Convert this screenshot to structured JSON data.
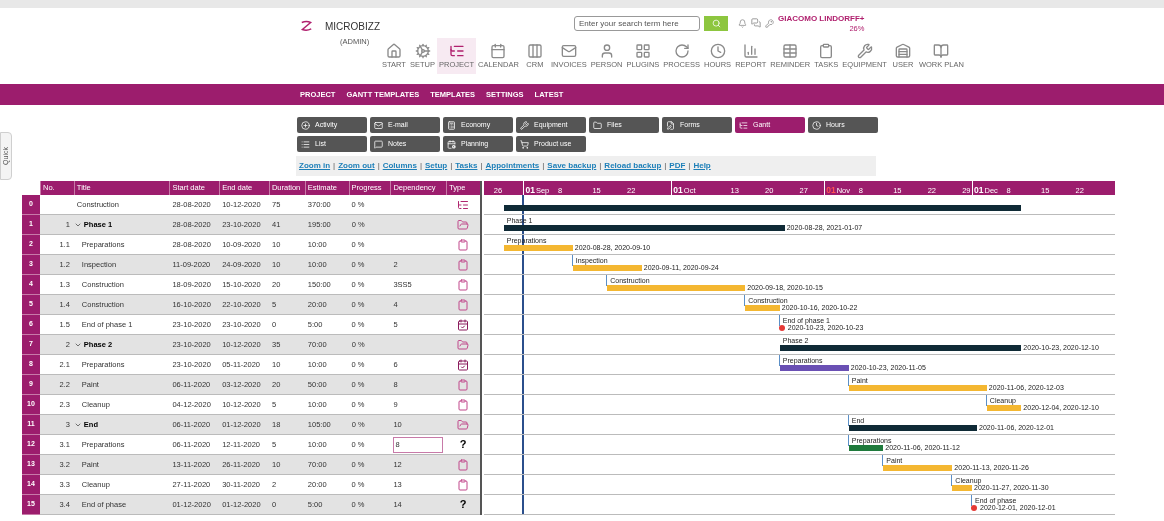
{
  "side_tab": {
    "label": "Quick"
  },
  "header": {
    "logo_text": "MICROBIZZ",
    "role": "(ADMIN)",
    "search": {
      "placeholder": "Enter your search term here"
    },
    "user": "GIACOMO LINDORFF+",
    "user_note": "26%"
  },
  "toolbar": [
    {
      "label": "START",
      "selected": false
    },
    {
      "label": "SETUP",
      "selected": false
    },
    {
      "label": "PROJECT",
      "selected": true
    },
    {
      "label": "CALENDAR",
      "selected": false
    },
    {
      "label": "CRM",
      "selected": false
    },
    {
      "label": "INVOICES",
      "selected": false
    },
    {
      "label": "PERSON",
      "selected": false
    },
    {
      "label": "PLUGINS",
      "selected": false
    },
    {
      "label": "PROCESS",
      "selected": false
    },
    {
      "label": "HOURS",
      "selected": false
    },
    {
      "label": "REPORT",
      "selected": false
    },
    {
      "label": "REMINDER",
      "selected": false
    },
    {
      "label": "TASKS",
      "selected": false
    },
    {
      "label": "EQUIPMENT",
      "selected": false
    },
    {
      "label": "USER",
      "selected": false
    },
    {
      "label": "WORK PLAN",
      "selected": false
    }
  ],
  "nav": [
    "PROJECT",
    "GANTT TEMPLATES",
    "TEMPLATES",
    "SETTINGS",
    "LATEST"
  ],
  "modules": [
    {
      "label": "Activity",
      "selected": false
    },
    {
      "label": "E-mail",
      "selected": false
    },
    {
      "label": "Economy",
      "selected": false
    },
    {
      "label": "Equipment",
      "selected": false
    },
    {
      "label": "Files",
      "selected": false
    },
    {
      "label": "Forms",
      "selected": false
    },
    {
      "label": "Gantt",
      "selected": true
    },
    {
      "label": "Hours",
      "selected": false
    },
    {
      "label": "List",
      "selected": false
    },
    {
      "label": "Notes",
      "selected": false
    },
    {
      "label": "Planning",
      "selected": false
    },
    {
      "label": "Product use",
      "selected": false
    }
  ],
  "links": {
    "separator": "|",
    "items": [
      "Zoom in",
      "Zoom out",
      "Columns",
      "Setup",
      "Tasks",
      "Appointments",
      "Save backup",
      "Reload backup",
      "PDF",
      "Help"
    ]
  },
  "table": {
    "columns": [
      "No.",
      "Title",
      "Start date",
      "End date",
      "Duration",
      "Estimate",
      "Progress",
      "Dependency",
      "Type"
    ],
    "rows": [
      {
        "row_number": "0",
        "no": "",
        "title": "Construction",
        "kind": "project",
        "start": "28-08-2020",
        "end": "10-12-2020",
        "duration": "75",
        "estimate": "370:00",
        "progress": "0 %",
        "dependency": "",
        "editing": false,
        "type": {
          "kind": "project"
        },
        "bar": {
          "kind": "summary",
          "color": "#0f2a36",
          "linked": false
        }
      },
      {
        "row_number": "1",
        "no": "1",
        "title": "Phase 1",
        "kind": "phase",
        "expanded": true,
        "start": "28-08-2020",
        "end": "23-10-2020",
        "duration": "41",
        "estimate": "195:00",
        "progress": "0 %",
        "dependency": "",
        "editing": false,
        "type": {
          "kind": "phase"
        },
        "bar": {
          "kind": "summary",
          "color": "#0f2a36",
          "linked": false,
          "label": "Phase 1",
          "dates": "2020-08-28, 2021-01-07"
        }
      },
      {
        "row_number": "2",
        "no": "1.1",
        "title": "Preparations",
        "kind": "task",
        "start": "28-08-2020",
        "end": "10-09-2020",
        "duration": "10",
        "estimate": "10:00",
        "progress": "0 %",
        "dependency": "",
        "editing": false,
        "type": {
          "kind": "task"
        },
        "bar": {
          "kind": "task",
          "color": "#f4b731",
          "linked": false,
          "label": "Preparations",
          "dates": "2020-08-28, 2020-09-10"
        }
      },
      {
        "row_number": "3",
        "no": "1.2",
        "title": "Inspection",
        "kind": "task",
        "start": "11-09-2020",
        "end": "24-09-2020",
        "duration": "10",
        "estimate": "10:00",
        "progress": "0 %",
        "dependency": "2",
        "editing": false,
        "type": {
          "kind": "task"
        },
        "bar": {
          "kind": "task",
          "color": "#f4b731",
          "linked": true,
          "label": "Inspection",
          "dates": "2020-09-11, 2020-09-24"
        }
      },
      {
        "row_number": "4",
        "no": "1.3",
        "title": "Construction",
        "kind": "task",
        "start": "18-09-2020",
        "end": "15-10-2020",
        "duration": "20",
        "estimate": "150:00",
        "progress": "0 %",
        "dependency": "3SS5",
        "editing": false,
        "type": {
          "kind": "task"
        },
        "bar": {
          "kind": "task",
          "color": "#f4b731",
          "linked": true,
          "label": "Construction",
          "dates": "2020-09-18, 2020-10-15"
        }
      },
      {
        "row_number": "5",
        "no": "1.4",
        "title": "Construction",
        "kind": "task",
        "start": "16-10-2020",
        "end": "22-10-2020",
        "duration": "5",
        "estimate": "20:00",
        "progress": "0 %",
        "dependency": "4",
        "editing": false,
        "type": {
          "kind": "task"
        },
        "bar": {
          "kind": "task",
          "color": "#f4b731",
          "linked": true,
          "label": "Construction",
          "dates": "2020-10-16, 2020-10-22"
        }
      },
      {
        "row_number": "6",
        "no": "1.5",
        "title": "End of phase 1",
        "kind": "task",
        "start": "23-10-2020",
        "end": "23-10-2020",
        "duration": "0",
        "estimate": "5:00",
        "progress": "0 %",
        "dependency": "5",
        "editing": false,
        "type": {
          "kind": "milestone"
        },
        "bar": {
          "kind": "milestone",
          "color": "#e53935",
          "linked": true,
          "label": "End of phase 1",
          "dates": "2020-10-23, 2020-10-23"
        }
      },
      {
        "row_number": "7",
        "no": "2",
        "title": "Phase 2",
        "kind": "phase",
        "expanded": true,
        "start": "23-10-2020",
        "end": "10-12-2020",
        "duration": "35",
        "estimate": "70:00",
        "progress": "0 %",
        "dependency": "",
        "editing": false,
        "type": {
          "kind": "phase"
        },
        "bar": {
          "kind": "summary",
          "color": "#0f2a36",
          "linked": false,
          "label": "Phase 2",
          "dates": "2020-10-23, 2020-12-10"
        }
      },
      {
        "row_number": "8",
        "no": "2.1",
        "title": "Preparations",
        "kind": "task",
        "start": "23-10-2020",
        "end": "05-11-2020",
        "duration": "10",
        "estimate": "10:00",
        "progress": "0 %",
        "dependency": "6",
        "editing": false,
        "type": {
          "kind": "milestone"
        },
        "bar": {
          "kind": "task",
          "color": "#6a50b4",
          "linked": true,
          "label": "Preparations",
          "dates": "2020-10-23, 2020-11-05"
        }
      },
      {
        "row_number": "9",
        "no": "2.2",
        "title": "Paint",
        "kind": "task",
        "start": "06-11-2020",
        "end": "03-12-2020",
        "duration": "20",
        "estimate": "50:00",
        "progress": "0 %",
        "dependency": "8",
        "editing": false,
        "type": {
          "kind": "task"
        },
        "bar": {
          "kind": "task",
          "color": "#f4b731",
          "linked": true,
          "label": "Paint",
          "dates": "2020-11-06, 2020-12-03"
        }
      },
      {
        "row_number": "10",
        "no": "2.3",
        "title": "Cleanup",
        "kind": "task",
        "start": "04-12-2020",
        "end": "10-12-2020",
        "duration": "5",
        "estimate": "10:00",
        "progress": "0 %",
        "dependency": "9",
        "editing": false,
        "type": {
          "kind": "task"
        },
        "bar": {
          "kind": "task",
          "color": "#f4b731",
          "linked": true,
          "label": "Cleanup",
          "dates": "2020-12-04, 2020-12-10"
        }
      },
      {
        "row_number": "11",
        "no": "3",
        "title": "End",
        "kind": "phase",
        "expanded": true,
        "start": "06-11-2020",
        "end": "01-12-2020",
        "duration": "18",
        "estimate": "105:00",
        "progress": "0 %",
        "dependency": "10",
        "editing": false,
        "type": {
          "kind": "phase"
        },
        "bar": {
          "kind": "summary",
          "color": "#0f2a36",
          "linked": true,
          "label": "End",
          "dates": "2020-11-06, 2020-12-01"
        }
      },
      {
        "row_number": "12",
        "no": "3.1",
        "title": "Preparations",
        "kind": "task",
        "start": "06-11-2020",
        "end": "12-11-2020",
        "duration": "5",
        "estimate": "10:00",
        "progress": "0 %",
        "dependency": "8",
        "editing": true,
        "type": {
          "kind": "text",
          "label": "?"
        },
        "bar": {
          "kind": "task",
          "color": "#1f7a3c",
          "linked": true,
          "label": "Preparations",
          "dates": "2020-11-06, 2020-11-12"
        }
      },
      {
        "row_number": "13",
        "no": "3.2",
        "title": "Paint",
        "kind": "task",
        "start": "13-11-2020",
        "end": "26-11-2020",
        "duration": "10",
        "estimate": "70:00",
        "progress": "0 %",
        "dependency": "12",
        "editing": false,
        "type": {
          "kind": "task"
        },
        "bar": {
          "kind": "task",
          "color": "#f4b731",
          "linked": true,
          "label": "Paint",
          "dates": "2020-11-13, 2020-11-26"
        }
      },
      {
        "row_number": "14",
        "no": "3.3",
        "title": "Cleanup",
        "kind": "task",
        "start": "27-11-2020",
        "end": "30-11-2020",
        "duration": "2",
        "estimate": "20:00",
        "progress": "0 %",
        "dependency": "13",
        "editing": false,
        "type": {
          "kind": "task"
        },
        "bar": {
          "kind": "task",
          "color": "#f4b731",
          "linked": true,
          "label": "Cleanup",
          "dates": "2020-11-27, 2020-11-30"
        }
      },
      {
        "row_number": "15",
        "no": "3.4",
        "title": "End of phase",
        "kind": "task",
        "start": "01-12-2020",
        "end": "01-12-2020",
        "duration": "0",
        "estimate": "5:00",
        "progress": "0 %",
        "dependency": "14",
        "editing": false,
        "type": {
          "kind": "text",
          "label": "?"
        },
        "bar": {
          "kind": "milestone",
          "color": "#e53935",
          "linked": true,
          "label": "End of phase",
          "dates": "2020-12-01, 2020-12-01"
        }
      }
    ]
  },
  "timeline": {
    "ticks": [
      {
        "day": "26",
        "current": false
      },
      {
        "day": "01",
        "month": "Sep",
        "current": false
      },
      {
        "day": "8",
        "current": false
      },
      {
        "day": "15",
        "current": false
      },
      {
        "day": "22",
        "current": false
      },
      {
        "day": "01",
        "month": "Oct",
        "current": false
      },
      {
        "day": "13",
        "current": false
      },
      {
        "day": "20",
        "current": false
      },
      {
        "day": "27",
        "current": false
      },
      {
        "day": "01",
        "month": "Nov",
        "current": true
      },
      {
        "day": "8",
        "current": false
      },
      {
        "day": "15",
        "current": false
      },
      {
        "day": "22",
        "current": false
      },
      {
        "day": "29",
        "current": false
      },
      {
        "day": "01",
        "month": "Dec",
        "current": false
      },
      {
        "day": "8",
        "current": false
      },
      {
        "day": "15",
        "current": false
      },
      {
        "day": "22",
        "current": false
      }
    ]
  }
}
